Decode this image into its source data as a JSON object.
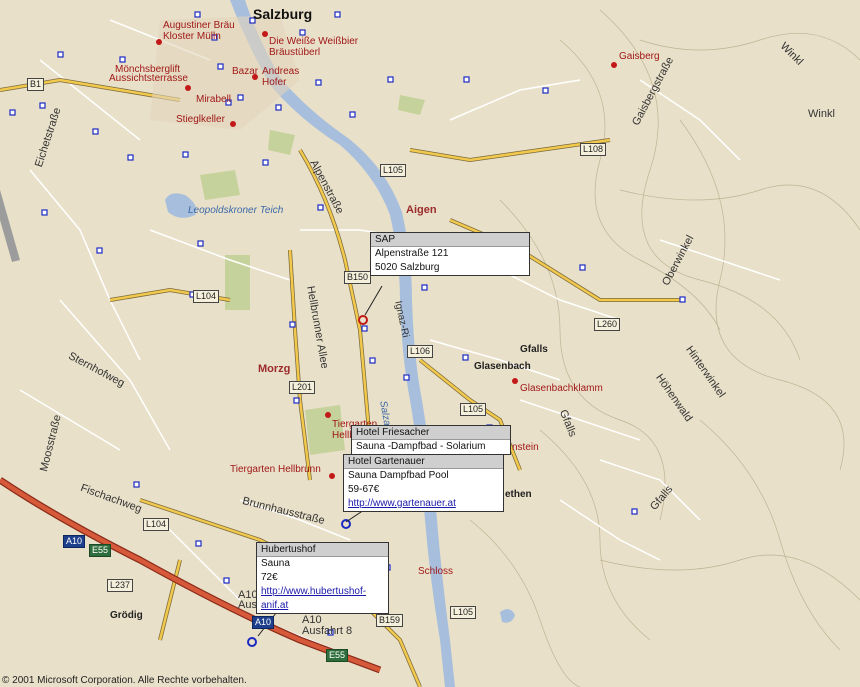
{
  "map": {
    "city": "Salzburg",
    "copyright": "© 2001 Microsoft Corporation. Alle Rechte vorbehalten.",
    "places": {
      "aigen": "Aigen",
      "morzg": "Morzg",
      "gfalls": "Gfalls",
      "glasenbach": "Glasenbach",
      "groedig": "Grödig",
      "winkl1": "Winkl",
      "winkl2": "Winkl"
    },
    "pois": {
      "augustiner": "Augustiner Bräu",
      "kloster": "Kloster Mülln",
      "weisse1": "Die Weiße Weißbier",
      "weisse2": "Bräustüberl",
      "moenchsberg1": "Mönchsberglift",
      "moenchsberg2": "Aussichtsterrasse",
      "andreas1": "Andreas",
      "andreas2": "Hofer",
      "mirabell": "Mirabell",
      "stiegl": "Stieglkeller",
      "bazar": "Bazar",
      "gaisberg": "Gaisberg",
      "klamm": "Glasenbachklamm",
      "tiergarten": "Tiergarten Hellbrunn",
      "tiergarten_short": "Tiergarten",
      "hellbrunn_short": "Hellb",
      "schloss": "Schloss",
      "stein": "nstein",
      "elsbethen": "ethen"
    },
    "water": {
      "teich": "Leopoldskroner Teich",
      "salzach": "Salzach"
    },
    "streets": {
      "alpenstrasse": "Alpenstraße",
      "ignaz": "Ignaz-Ri",
      "hellbrunner": "Hellbrunner Allee",
      "brunnhaus": "Brunnhausstraße",
      "sternhof": "Sternhofweg",
      "moos": "Moosstraße",
      "fischach": "Fischachweg",
      "eichet": "Eichetstraße",
      "gaisberg": "Gaisbergstraße",
      "oberwinkl": "Oberwinkel",
      "hinterwinkl": "Hinterwinkel",
      "hoehenwald": "Höhenwald",
      "gfalls_st": "Gfalls",
      "gfalls2": "Gfalls"
    },
    "shields": {
      "b1": "B1",
      "l108": "L108",
      "l105a": "L105",
      "b150": "B150",
      "l104a": "L104",
      "l106": "L106",
      "l260": "L260",
      "l201": "L201",
      "l105b": "L105",
      "l104b": "L104",
      "a10": "A10",
      "e55a": "E55",
      "l237": "L237",
      "b159": "B159",
      "l105c": "L105",
      "a10b": "A10",
      "e55b": "E55"
    },
    "exits": {
      "a10_ausfahrt": "A10",
      "ausfahrt_label": "Ausfahrt 8",
      "a10_left": "A10",
      "ausf_left": "Ausf"
    }
  },
  "callouts": {
    "sap": {
      "title": "SAP",
      "lines": [
        "Alpenstraße 121",
        "5020 Salzburg"
      ]
    },
    "friesacher": {
      "title": "Hotel Friesacher",
      "lines": [
        "Sauna -Dampfbad - Solarium"
      ]
    },
    "gartenauer": {
      "title": "Hotel Gartenauer",
      "lines": [
        "Sauna Dampfbad Pool",
        "59-67€"
      ],
      "link": "http://www.gartenauer.at"
    },
    "hubertushof": {
      "title": "Hubertushof",
      "lines": [
        "Sauna",
        "72€"
      ],
      "link1": "http://www.hubertushof-",
      "link2": "anif.at"
    }
  },
  "colors": {
    "land": "#e9e0c9",
    "water": "#a7bfdc",
    "major_road": "#f2c94c",
    "motorway": "#d65a3a",
    "minor_road": "#ffffff",
    "park": "#c6d29b",
    "contour": "#b7ab8c"
  }
}
